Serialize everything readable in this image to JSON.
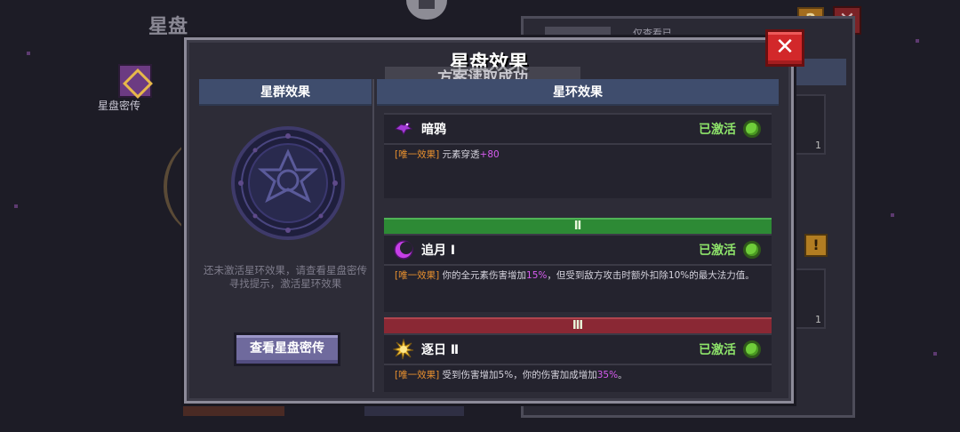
{
  "background": {
    "title": "星盘",
    "side_label": "星盘密传",
    "help_label": "?",
    "close_label": "✕",
    "right_tab_label": "仅查看已",
    "slot_counts": [
      "1",
      "1"
    ],
    "coin_label": "!"
  },
  "modal": {
    "title": "星盘效果",
    "toast": "方案读取成功",
    "close_label": "✕",
    "left": {
      "header": "星群效果",
      "note": "还未激活星环效果，请查看星盘密传寻找提示，激活星环效果",
      "button": "查看星盘密传"
    },
    "right": {
      "header": "星环效果",
      "entries": [
        {
          "name": "暗鸦",
          "status": "已激活",
          "tag": "[唯一效果]",
          "desc_before": "元素穿透",
          "desc_highlight": "+80",
          "desc_after": ""
        },
        {
          "name": "追月 Ⅰ",
          "status": "已激活",
          "tag": "[唯一效果]",
          "desc_before": "你的全元素伤害增加",
          "desc_highlight": "15%",
          "desc_after": "，但受到敌方攻击时额外扣除10%的最大法力值。"
        },
        {
          "name": "逐日 Ⅱ",
          "status": "已激活",
          "tag": "[唯一效果]",
          "desc_before": "受到伤害增加5%，你的伤害加成增加",
          "desc_highlight": "35%",
          "desc_after": "。"
        }
      ],
      "tiers": [
        "Ⅱ",
        "Ⅲ"
      ]
    }
  },
  "colors": {
    "active_green": "#8ee36a",
    "tag_orange": "#e8902e",
    "highlight_purple": "#d75cf0",
    "tier2_green": "#2d8a35",
    "tier3_red": "#8a2834",
    "header_blue": "#3f4d6d"
  },
  "icons": {
    "entry_0": "crow-icon",
    "entry_1": "crescent-moon-icon",
    "entry_2": "sun-icon"
  }
}
